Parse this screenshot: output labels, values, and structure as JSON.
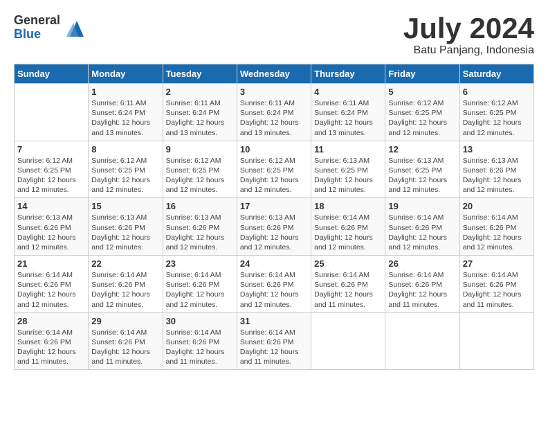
{
  "logo": {
    "general": "General",
    "blue": "Blue"
  },
  "title": "July 2024",
  "location": "Batu Panjang, Indonesia",
  "days_of_week": [
    "Sunday",
    "Monday",
    "Tuesday",
    "Wednesday",
    "Thursday",
    "Friday",
    "Saturday"
  ],
  "weeks": [
    [
      {
        "day": "",
        "info": ""
      },
      {
        "day": "1",
        "info": "Sunrise: 6:11 AM\nSunset: 6:24 PM\nDaylight: 12 hours and 13 minutes."
      },
      {
        "day": "2",
        "info": "Sunrise: 6:11 AM\nSunset: 6:24 PM\nDaylight: 12 hours and 13 minutes."
      },
      {
        "day": "3",
        "info": "Sunrise: 6:11 AM\nSunset: 6:24 PM\nDaylight: 12 hours and 13 minutes."
      },
      {
        "day": "4",
        "info": "Sunrise: 6:11 AM\nSunset: 6:24 PM\nDaylight: 12 hours and 13 minutes."
      },
      {
        "day": "5",
        "info": "Sunrise: 6:12 AM\nSunset: 6:25 PM\nDaylight: 12 hours and 12 minutes."
      },
      {
        "day": "6",
        "info": "Sunrise: 6:12 AM\nSunset: 6:25 PM\nDaylight: 12 hours and 12 minutes."
      }
    ],
    [
      {
        "day": "7",
        "info": "Sunrise: 6:12 AM\nSunset: 6:25 PM\nDaylight: 12 hours and 12 minutes."
      },
      {
        "day": "8",
        "info": "Sunrise: 6:12 AM\nSunset: 6:25 PM\nDaylight: 12 hours and 12 minutes."
      },
      {
        "day": "9",
        "info": "Sunrise: 6:12 AM\nSunset: 6:25 PM\nDaylight: 12 hours and 12 minutes."
      },
      {
        "day": "10",
        "info": "Sunrise: 6:12 AM\nSunset: 6:25 PM\nDaylight: 12 hours and 12 minutes."
      },
      {
        "day": "11",
        "info": "Sunrise: 6:13 AM\nSunset: 6:25 PM\nDaylight: 12 hours and 12 minutes."
      },
      {
        "day": "12",
        "info": "Sunrise: 6:13 AM\nSunset: 6:25 PM\nDaylight: 12 hours and 12 minutes."
      },
      {
        "day": "13",
        "info": "Sunrise: 6:13 AM\nSunset: 6:26 PM\nDaylight: 12 hours and 12 minutes."
      }
    ],
    [
      {
        "day": "14",
        "info": "Sunrise: 6:13 AM\nSunset: 6:26 PM\nDaylight: 12 hours and 12 minutes."
      },
      {
        "day": "15",
        "info": "Sunrise: 6:13 AM\nSunset: 6:26 PM\nDaylight: 12 hours and 12 minutes."
      },
      {
        "day": "16",
        "info": "Sunrise: 6:13 AM\nSunset: 6:26 PM\nDaylight: 12 hours and 12 minutes."
      },
      {
        "day": "17",
        "info": "Sunrise: 6:13 AM\nSunset: 6:26 PM\nDaylight: 12 hours and 12 minutes."
      },
      {
        "day": "18",
        "info": "Sunrise: 6:14 AM\nSunset: 6:26 PM\nDaylight: 12 hours and 12 minutes."
      },
      {
        "day": "19",
        "info": "Sunrise: 6:14 AM\nSunset: 6:26 PM\nDaylight: 12 hours and 12 minutes."
      },
      {
        "day": "20",
        "info": "Sunrise: 6:14 AM\nSunset: 6:26 PM\nDaylight: 12 hours and 12 minutes."
      }
    ],
    [
      {
        "day": "21",
        "info": "Sunrise: 6:14 AM\nSunset: 6:26 PM\nDaylight: 12 hours and 12 minutes."
      },
      {
        "day": "22",
        "info": "Sunrise: 6:14 AM\nSunset: 6:26 PM\nDaylight: 12 hours and 12 minutes."
      },
      {
        "day": "23",
        "info": "Sunrise: 6:14 AM\nSunset: 6:26 PM\nDaylight: 12 hours and 12 minutes."
      },
      {
        "day": "24",
        "info": "Sunrise: 6:14 AM\nSunset: 6:26 PM\nDaylight: 12 hours and 12 minutes."
      },
      {
        "day": "25",
        "info": "Sunrise: 6:14 AM\nSunset: 6:26 PM\nDaylight: 12 hours and 11 minutes."
      },
      {
        "day": "26",
        "info": "Sunrise: 6:14 AM\nSunset: 6:26 PM\nDaylight: 12 hours and 11 minutes."
      },
      {
        "day": "27",
        "info": "Sunrise: 6:14 AM\nSunset: 6:26 PM\nDaylight: 12 hours and 11 minutes."
      }
    ],
    [
      {
        "day": "28",
        "info": "Sunrise: 6:14 AM\nSunset: 6:26 PM\nDaylight: 12 hours and 11 minutes."
      },
      {
        "day": "29",
        "info": "Sunrise: 6:14 AM\nSunset: 6:26 PM\nDaylight: 12 hours and 11 minutes."
      },
      {
        "day": "30",
        "info": "Sunrise: 6:14 AM\nSunset: 6:26 PM\nDaylight: 12 hours and 11 minutes."
      },
      {
        "day": "31",
        "info": "Sunrise: 6:14 AM\nSunset: 6:26 PM\nDaylight: 12 hours and 11 minutes."
      },
      {
        "day": "",
        "info": ""
      },
      {
        "day": "",
        "info": ""
      },
      {
        "day": "",
        "info": ""
      }
    ]
  ]
}
